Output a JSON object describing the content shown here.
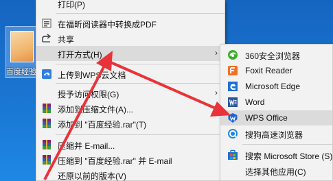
{
  "desktop": {
    "icon_label": "百度经验"
  },
  "context_menu": {
    "items": [
      {
        "label": "打印(P)",
        "icon": "none"
      },
      {
        "label": "在福昕阅读器中转换成PDF",
        "icon": "pdf-convert-icon"
      },
      {
        "label": "共享",
        "icon": "share-icon"
      },
      {
        "label": "打开方式(H)",
        "icon": "none",
        "submenu": true
      },
      {
        "label": "上传到WPS云文档",
        "icon": "wps-cloud-icon"
      },
      {
        "label": "授予访问权限(G)",
        "icon": "none",
        "submenu": true
      },
      {
        "label": "添加到压缩文件(A)...",
        "icon": "winrar-icon"
      },
      {
        "label": "添加到 \"百度经验.rar\"(T)",
        "icon": "winrar-icon"
      },
      {
        "label": "压缩并 E-mail...",
        "icon": "winrar-icon"
      },
      {
        "label": "压缩到 \"百度经验.rar\" 并 E-mail",
        "icon": "winrar-icon"
      },
      {
        "label": "还原以前的版本(V)",
        "icon": "none"
      }
    ],
    "submenu_arrow": "›"
  },
  "open_with_submenu": {
    "items": [
      {
        "label": "360安全浏览器",
        "icon": "360-browser-icon"
      },
      {
        "label": "Foxit Reader",
        "icon": "foxit-reader-icon"
      },
      {
        "label": "Microsoft Edge",
        "icon": "edge-icon"
      },
      {
        "label": "Word",
        "icon": "word-icon"
      },
      {
        "label": "WPS Office",
        "icon": "wps-office-icon"
      },
      {
        "label": "搜狗高速浏览器",
        "icon": "sogou-browser-icon"
      },
      {
        "label": "搜索 Microsoft Store (S)",
        "icon": "store-icon"
      },
      {
        "label": "选择其他应用(C)",
        "icon": "none"
      }
    ]
  },
  "colors": {
    "annotation_arrow": "#e8333a",
    "menu_bg": "#f2f2f2",
    "hover_bg": "#dbdbdb",
    "desktop_bg": "#1a6fc4"
  }
}
